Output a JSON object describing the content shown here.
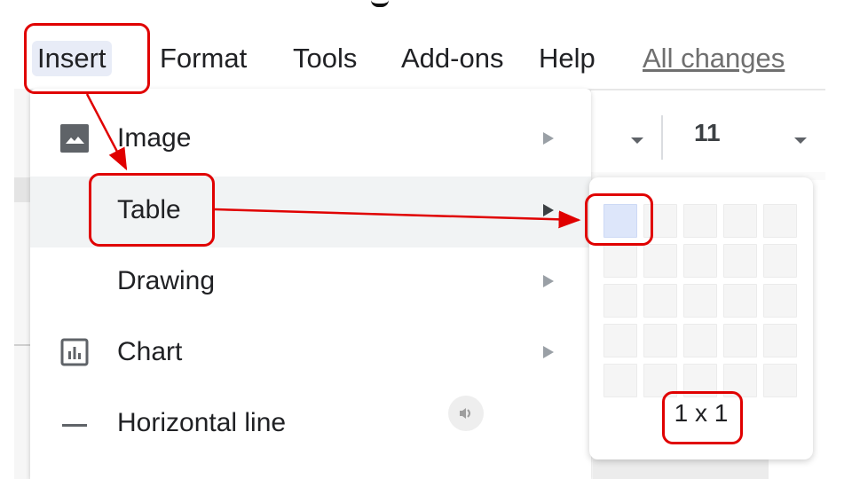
{
  "menubar": {
    "items": [
      {
        "label": "Insert",
        "active": true
      },
      {
        "label": "Format"
      },
      {
        "label": "Tools"
      },
      {
        "label": "Add-ons"
      },
      {
        "label": "Help"
      }
    ],
    "save_status": "All changes"
  },
  "toolbar": {
    "font_size": "11"
  },
  "insert_menu": {
    "items": [
      {
        "label": "Image",
        "icon": "image-icon",
        "submenu": true
      },
      {
        "label": "Table",
        "icon": null,
        "submenu": true,
        "highlighted": true
      },
      {
        "label": "Drawing",
        "icon": null,
        "submenu": true
      },
      {
        "label": "Chart",
        "icon": "chart-icon",
        "submenu": true
      },
      {
        "label": "Horizontal line",
        "icon": "horizontal-line-icon",
        "submenu": false
      }
    ]
  },
  "table_picker": {
    "rows": 5,
    "cols": 5,
    "selected_rows": 1,
    "selected_cols": 1,
    "size_label": "1 x 1"
  },
  "annotations": {
    "color": "#e00000"
  },
  "colors": {
    "active_menu_bg": "#e8ecf7",
    "hover_bg": "#f1f3f4",
    "selected_cell": "#dde6fa"
  }
}
